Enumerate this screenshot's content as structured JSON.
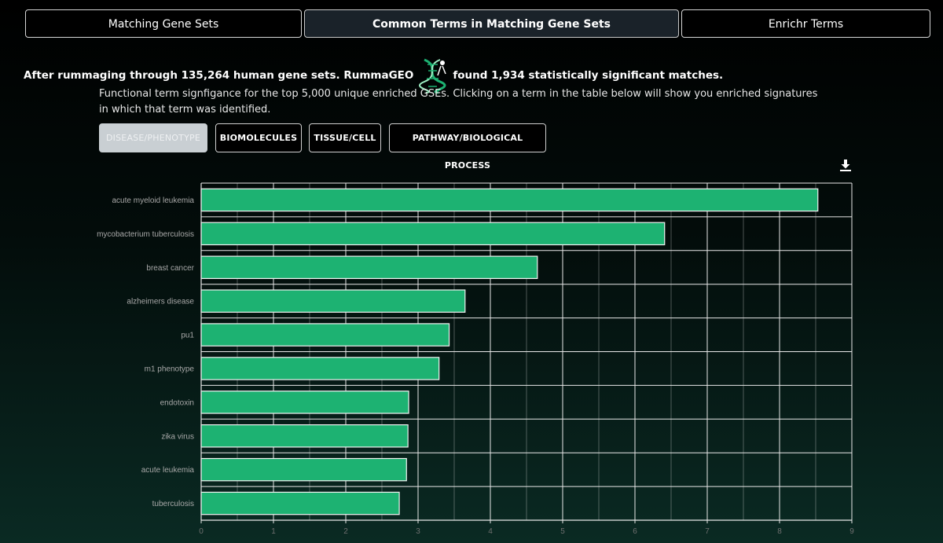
{
  "tabs": [
    {
      "label": "Matching Gene Sets"
    },
    {
      "label": "Common Terms in Matching Gene Sets"
    },
    {
      "label": "Enrichr Terms"
    }
  ],
  "headline": {
    "before": "After rummaging through 135,264 human gene sets. RummaGEO",
    "after": "found 1,934 statistically significant matches."
  },
  "description": "Functional term signfigance for the top 5,000 unique enriched GSEs. Clicking on a term in the table below will show you enriched signatures in which that term was identified.",
  "categories": [
    {
      "label": "DISEASE/PHENOTYPE"
    },
    {
      "label": "BIOMOLECULES"
    },
    {
      "label": "TISSUE/CELL"
    },
    {
      "label": "PATHWAY/BIOLOGICAL PROCESS"
    }
  ],
  "colors": {
    "bar": "#1db272",
    "grid": "#e8e8e8",
    "label": "#a8a8a8"
  },
  "icons": {
    "download": "download-icon",
    "logo": "dna-logo"
  },
  "chart_data": {
    "type": "bar",
    "orientation": "horizontal",
    "categories": [
      "acute myeloid leukemia",
      "mycobacterium tuberculosis",
      "breast cancer",
      "alzheimers disease",
      "pu1",
      "m1 phenotype",
      "endotoxin",
      "zika virus",
      "acute leukemia",
      "tuberculosis"
    ],
    "values": [
      8.53,
      6.41,
      4.65,
      3.65,
      3.43,
      3.29,
      2.87,
      2.86,
      2.84,
      2.74
    ],
    "xlim": [
      0,
      9
    ],
    "xticks": [
      "0",
      "1",
      "2",
      "3",
      "4",
      "5",
      "6",
      "7",
      "8",
      "9"
    ],
    "grid": true
  }
}
